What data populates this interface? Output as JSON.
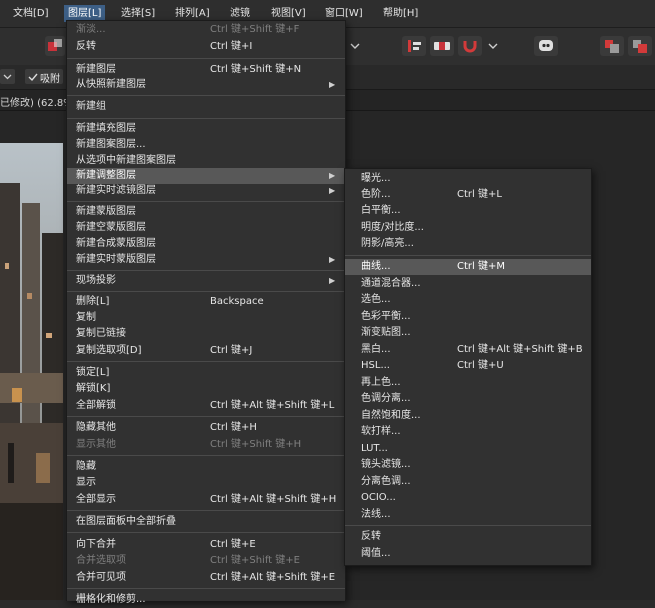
{
  "menubar": {
    "items": [
      {
        "label": "文档[D]"
      },
      {
        "label": "图层[L]"
      },
      {
        "label": "选择[S]"
      },
      {
        "label": "排列[A]"
      },
      {
        "label": "滤镜"
      },
      {
        "label": "视图[V]"
      },
      {
        "label": "窗口[W]"
      },
      {
        "label": "帮助[H]"
      }
    ]
  },
  "context_bar": {
    "snap_label": "吸附"
  },
  "doc_tab": {
    "title": "已修改) (62.8%"
  },
  "layer_menu": {
    "items": [
      {
        "label": "渐淡...",
        "shortcut": "Ctrl 键+Shift 键+F"
      },
      {
        "label": "反转",
        "shortcut": "Ctrl 键+I"
      },
      {
        "label": "新建图层",
        "shortcut": "Ctrl 键+Shift 键+N"
      },
      {
        "label": "从快照新建图层",
        "shortcut": ""
      },
      {
        "label": "新建组",
        "shortcut": ""
      },
      {
        "label": "新建填充图层",
        "shortcut": ""
      },
      {
        "label": "新建图案图层...",
        "shortcut": ""
      },
      {
        "label": "从选项中新建图案图层",
        "shortcut": ""
      },
      {
        "label": "新建调整图层",
        "shortcut": ""
      },
      {
        "label": "新建实时滤镜图层",
        "shortcut": ""
      },
      {
        "label": "新建蒙版图层",
        "shortcut": ""
      },
      {
        "label": "新建空蒙版图层",
        "shortcut": ""
      },
      {
        "label": "新建合成蒙版图层",
        "shortcut": ""
      },
      {
        "label": "新建实时蒙版图层",
        "shortcut": ""
      },
      {
        "label": "现场投影",
        "shortcut": ""
      },
      {
        "label": "删除[L]",
        "shortcut": "Backspace"
      },
      {
        "label": "复制",
        "shortcut": ""
      },
      {
        "label": "复制已链接",
        "shortcut": ""
      },
      {
        "label": "复制选取项[D]",
        "shortcut": "Ctrl 键+J"
      },
      {
        "label": "锁定[L]",
        "shortcut": ""
      },
      {
        "label": "解锁[K]",
        "shortcut": ""
      },
      {
        "label": "全部解锁",
        "shortcut": "Ctrl 键+Alt 键+Shift 键+L"
      },
      {
        "label": "隐藏其他",
        "shortcut": "Ctrl 键+H"
      },
      {
        "label": "显示其他",
        "shortcut": "Ctrl 键+Shift 键+H"
      },
      {
        "label": "隐藏",
        "shortcut": ""
      },
      {
        "label": "显示",
        "shortcut": ""
      },
      {
        "label": "全部显示",
        "shortcut": "Ctrl 键+Alt 键+Shift 键+H"
      },
      {
        "label": "在图层面板中全部折叠",
        "shortcut": ""
      },
      {
        "label": "向下合并",
        "shortcut": "Ctrl 键+E"
      },
      {
        "label": "合并选取项",
        "shortcut": "Ctrl 键+Shift 键+E"
      },
      {
        "label": "合并可见项",
        "shortcut": "Ctrl 键+Alt 键+Shift 键+E"
      },
      {
        "label": "栅格化和修剪...",
        "shortcut": ""
      }
    ]
  },
  "adjust_menu": {
    "items": [
      {
        "label": "曝光...",
        "shortcut": ""
      },
      {
        "label": "色阶...",
        "shortcut": "Ctrl 键+L"
      },
      {
        "label": "白平衡...",
        "shortcut": ""
      },
      {
        "label": "明度/对比度...",
        "shortcut": ""
      },
      {
        "label": "阴影/高亮...",
        "shortcut": ""
      },
      {
        "label": "曲线...",
        "shortcut": "Ctrl 键+M"
      },
      {
        "label": "通道混合器...",
        "shortcut": ""
      },
      {
        "label": "选色...",
        "shortcut": ""
      },
      {
        "label": "色彩平衡...",
        "shortcut": ""
      },
      {
        "label": "渐变贴图...",
        "shortcut": ""
      },
      {
        "label": "黑白...",
        "shortcut": "Ctrl 键+Alt 键+Shift 键+B"
      },
      {
        "label": "HSL...",
        "shortcut": "Ctrl 键+U"
      },
      {
        "label": "再上色...",
        "shortcut": ""
      },
      {
        "label": "色调分离...",
        "shortcut": ""
      },
      {
        "label": "自然饱和度...",
        "shortcut": ""
      },
      {
        "label": "软打样...",
        "shortcut": ""
      },
      {
        "label": "LUT...",
        "shortcut": ""
      },
      {
        "label": "镜头滤镜...",
        "shortcut": ""
      },
      {
        "label": "分离色调...",
        "shortcut": ""
      },
      {
        "label": "OCIO...",
        "shortcut": ""
      },
      {
        "label": "法线...",
        "shortcut": ""
      },
      {
        "label": "反转",
        "shortcut": ""
      },
      {
        "label": "阈值...",
        "shortcut": ""
      }
    ]
  }
}
